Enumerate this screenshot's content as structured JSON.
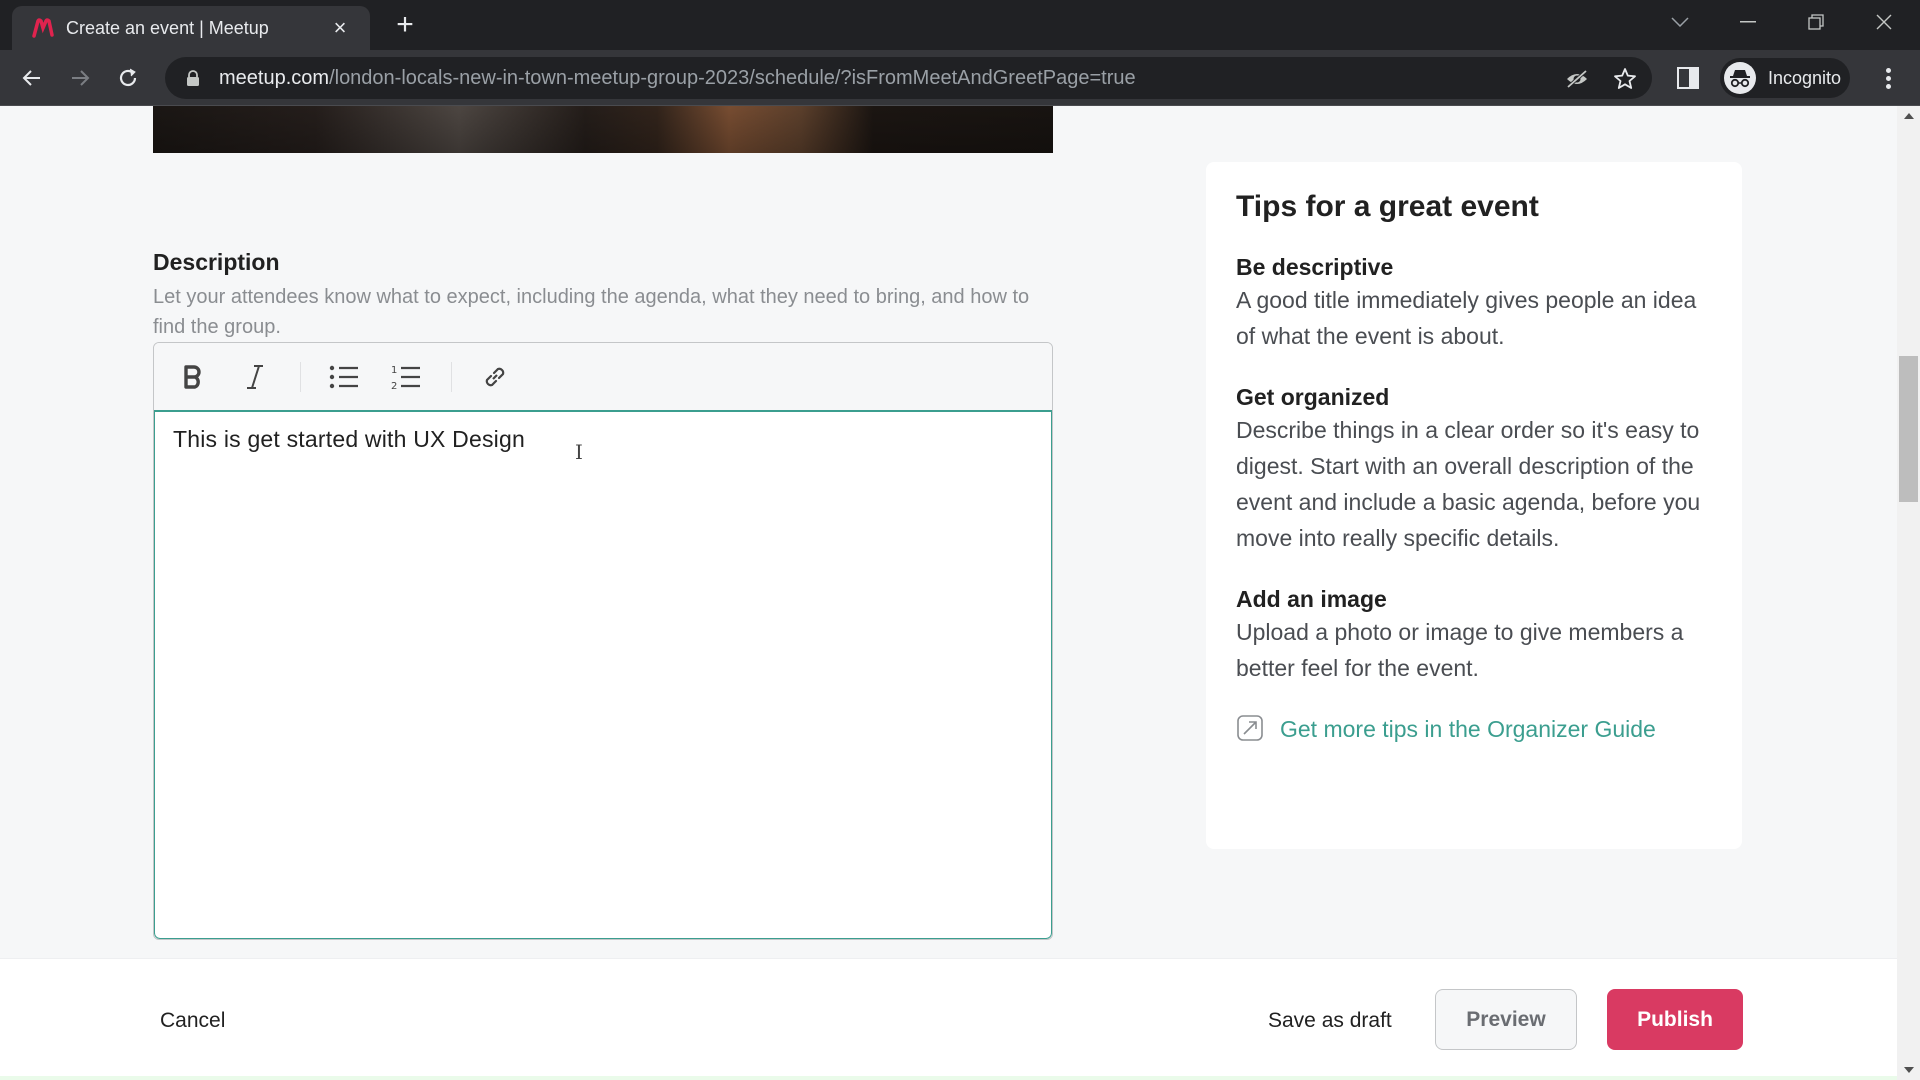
{
  "browser": {
    "tab_title": "Create an event | Meetup",
    "new_tab_symbol": "+",
    "close_symbol": "×",
    "url_host": "meetup.com",
    "url_path": "/london-locals-new-in-town-meetup-group-2023/schedule/?isFromMeetAndGreetPage=true",
    "profile_label": "Incognito",
    "brand_color": "#e0234e"
  },
  "description": {
    "label": "Description",
    "help_text": "Let your attendees know what to expect, including the agenda, what they need to bring, and how to find the group.",
    "toolbar": [
      "bold-icon",
      "italic-icon",
      "bullet-list-icon",
      "numbered-list-icon",
      "link-icon"
    ],
    "content": "This is get started with UX Design",
    "accent_color": "#3b9e8f"
  },
  "tips": {
    "title": "Tips for a great event",
    "items": [
      {
        "heading": "Be descriptive",
        "body": "A good title immediately gives people an idea of what the event is about."
      },
      {
        "heading": "Get organized",
        "body": "Describe things in a clear order so it's easy to digest. Start with an overall description of the event and include a basic agenda, before you move into really specific details."
      },
      {
        "heading": "Add an image",
        "body": "Upload a photo or image to give members a better feel for the event."
      }
    ],
    "guide_link": "Get more tips in the Organizer Guide"
  },
  "actions": {
    "cancel": "Cancel",
    "save_draft": "Save as draft",
    "preview": "Preview",
    "publish": "Publish",
    "publish_color": "#d93a62"
  }
}
